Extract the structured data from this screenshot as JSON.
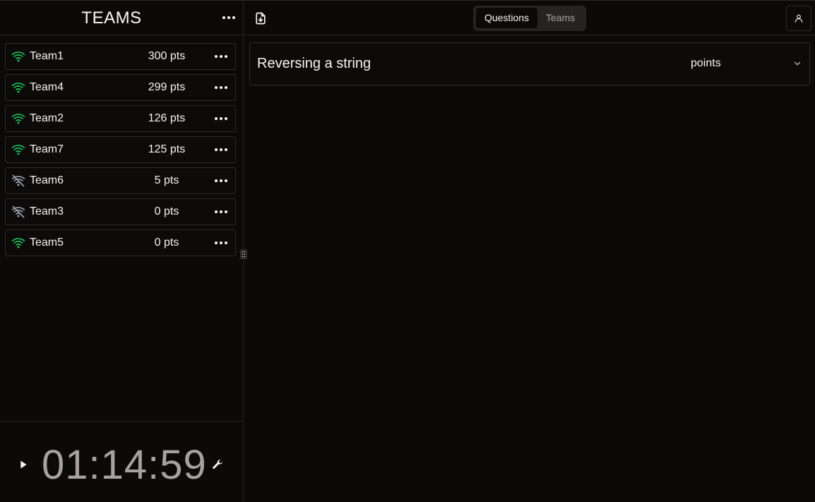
{
  "sidebar": {
    "title": "TEAMS",
    "teams": [
      {
        "name": "Team1",
        "points": "300 pts",
        "status": "wifi-icon",
        "color": "#22c55e"
      },
      {
        "name": "Team4",
        "points": "299 pts",
        "status": "wifi-icon",
        "color": "#22c55e"
      },
      {
        "name": "Team2",
        "points": "126 pts",
        "status": "wifi-icon",
        "color": "#22c55e"
      },
      {
        "name": "Team7",
        "points": "125 pts",
        "status": "wifi-icon",
        "color": "#22c55e"
      },
      {
        "name": "Team6",
        "points": "5 pts",
        "status": "wifi-off-icon",
        "color": "#9ca3af"
      },
      {
        "name": "Team3",
        "points": "0 pts",
        "status": "wifi-off-icon",
        "color": "#9ca3af"
      },
      {
        "name": "Team5",
        "points": "0 pts",
        "status": "wifi-icon",
        "color": "#22c55e"
      }
    ]
  },
  "timer": {
    "value": "01:14:59"
  },
  "main": {
    "tabs": [
      {
        "label": "Questions",
        "active": true
      },
      {
        "label": "Teams",
        "active": false
      }
    ],
    "questions": [
      {
        "title": "Reversing a string",
        "points_label": "points"
      }
    ]
  },
  "colors": {
    "background": "#0b0a09",
    "online": "#22c55e",
    "offline": "#9ca3af",
    "timer": "#a8a29e"
  }
}
